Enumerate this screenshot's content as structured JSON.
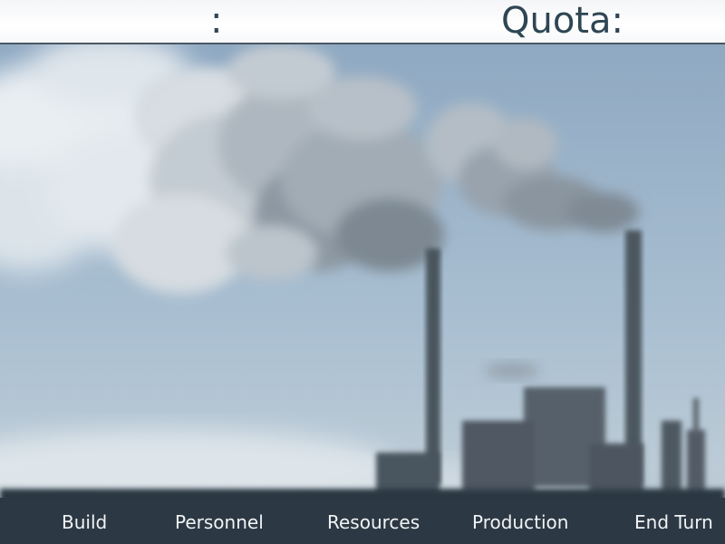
{
  "hud": {
    "left_stat_label": ":",
    "quota_label": "Quota:"
  },
  "menu": {
    "items": [
      {
        "label": "Build"
      },
      {
        "label": "Personnel"
      },
      {
        "label": "Resources"
      },
      {
        "label": "Production"
      },
      {
        "label": "End Turn"
      }
    ]
  },
  "colors": {
    "hud_text": "#2f4654",
    "hud_border": "#4b5763",
    "menu_text": "#f1f4f6",
    "sky": "#9fb5c8",
    "ground": "#2c3843"
  }
}
